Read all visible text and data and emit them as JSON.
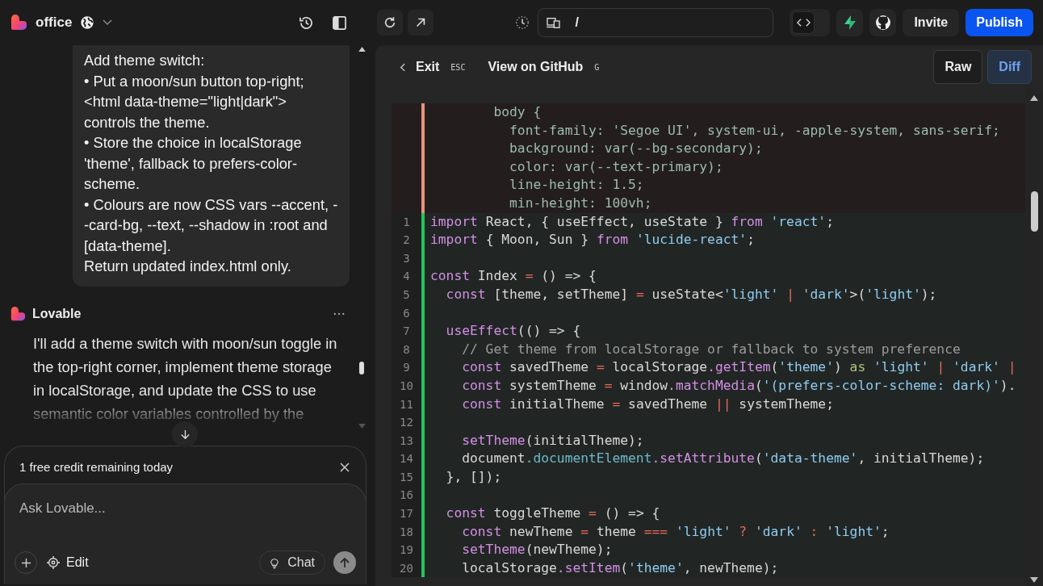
{
  "topbar": {
    "project": "office",
    "address": "/",
    "code_view": {
      "selected": true
    },
    "invite": "Invite",
    "publish": "Publish"
  },
  "chat": {
    "user_message": [
      "Add theme switch:",
      "• Put a moon/sun button top-right; <html data-theme=\"light|dark\"> controls the theme.",
      "• Store the choice in localStorage 'theme', fallback to prefers-color-scheme.",
      "• Colours are now CSS vars --accent, --card-bg, --text, --shadow in :root and [data-theme].",
      "Return updated index.html only."
    ],
    "assistant_name": "Lovable",
    "assistant_message": "I'll add a theme switch with moon/sun toggle in the top-right corner, implement theme storage in localStorage, and update the CSS to use semantic color variables controlled by the",
    "notice": "1 free credit remaining today",
    "input": {
      "placeholder": "Ask Lovable..."
    },
    "edit_button": "Edit",
    "chat_button": "Chat"
  },
  "viewer": {
    "exit": "Exit",
    "exit_key": "ESC",
    "github": "View on GitHub",
    "github_key": "G",
    "modes": [
      {
        "label": "Raw",
        "selected": false
      },
      {
        "label": "Diff",
        "selected": true
      }
    ],
    "lines": [
      {
        "kind": "removed",
        "tokens": [
          {
            "text": "        body {"
          }
        ]
      },
      {
        "kind": "removed",
        "tokens": [
          {
            "text": "          font-family: 'Segoe UI', system-ui, -apple-system, sans-serif;"
          }
        ]
      },
      {
        "kind": "removed",
        "tokens": [
          {
            "text": "          background: var(--bg-secondary);"
          }
        ]
      },
      {
        "kind": "removed",
        "tokens": [
          {
            "text": "          color: var(--text-primary);"
          }
        ]
      },
      {
        "kind": "removed",
        "tokens": [
          {
            "text": "          line-height: 1.5;"
          }
        ]
      },
      {
        "kind": "removed",
        "tokens": [
          {
            "text": "          min-height: 100vh;"
          }
        ]
      },
      {
        "kind": "added",
        "number": "1",
        "tokens": [
          {
            "text": "import",
            "kind": "kw"
          },
          {
            "text": " React, { useEffect, useState } "
          },
          {
            "text": "from ",
            "kind": "kw"
          },
          {
            "text": "'react'",
            "kind": "str"
          },
          {
            "text": ";"
          }
        ]
      },
      {
        "kind": "added",
        "number": "2",
        "tokens": [
          {
            "text": "import",
            "kind": "kw"
          },
          {
            "text": " { Moon, Sun } "
          },
          {
            "text": "from ",
            "kind": "kw"
          },
          {
            "text": "'lucide-react'",
            "kind": "str"
          },
          {
            "text": ";"
          }
        ]
      },
      {
        "kind": "added",
        "number": "3"
      },
      {
        "kind": "added",
        "number": "4",
        "tokens": [
          {
            "text": "const",
            "kind": "kw"
          },
          {
            "text": " Index "
          },
          {
            "text": "=",
            "kind": "op"
          },
          {
            "text": " () => {"
          }
        ]
      },
      {
        "kind": "added",
        "number": "5",
        "tokens": [
          {
            "text": "  const",
            "kind": "kw"
          },
          {
            "text": " [theme, setTheme] "
          },
          {
            "text": "=",
            "kind": "op"
          },
          {
            "text": " useState<"
          },
          {
            "text": "'light' ",
            "kind": "str"
          },
          {
            "text": "| ",
            "kind": "op"
          },
          {
            "text": "'dark'",
            "kind": "str"
          },
          {
            "text": ">("
          },
          {
            "text": "'light'",
            "kind": "str"
          },
          {
            "text": ");"
          }
        ]
      },
      {
        "kind": "added",
        "number": "6"
      },
      {
        "kind": "added",
        "number": "7",
        "tokens": [
          {
            "text": "  useEffect",
            "kind": "kw"
          },
          {
            "text": "(() => {"
          }
        ]
      },
      {
        "kind": "added",
        "number": "8",
        "tokens": [
          {
            "text": "    // Get theme from localStorage or fallback to system preference",
            "kind": "cm"
          }
        ]
      },
      {
        "kind": "added",
        "number": "9",
        "tokens": [
          {
            "text": "    const",
            "kind": "kw"
          },
          {
            "text": " savedTheme "
          },
          {
            "text": "=",
            "kind": "op"
          },
          {
            "text": " localStorage"
          },
          {
            "text": ".getItem",
            "kind": "kw"
          },
          {
            "text": "("
          },
          {
            "text": "'theme'",
            "kind": "str"
          },
          {
            "text": ") "
          },
          {
            "text": "as ",
            "kind": "as"
          },
          {
            "text": "'light' ",
            "kind": "str"
          },
          {
            "text": "| ",
            "kind": "op"
          },
          {
            "text": "'dark' ",
            "kind": "str"
          },
          {
            "text": "|",
            "kind": "op"
          }
        ]
      },
      {
        "kind": "added",
        "number": "10",
        "tokens": [
          {
            "text": "    const",
            "kind": "kw"
          },
          {
            "text": " systemTheme "
          },
          {
            "text": "=",
            "kind": "op"
          },
          {
            "text": " window"
          },
          {
            "text": ".matchMedia",
            "kind": "kw"
          },
          {
            "text": "("
          },
          {
            "text": "'(prefers-color-scheme: dark)'",
            "kind": "str"
          },
          {
            "text": ")."
          }
        ]
      },
      {
        "kind": "added",
        "number": "11",
        "tokens": [
          {
            "text": "    const",
            "kind": "kw"
          },
          {
            "text": " initialTheme "
          },
          {
            "text": "=",
            "kind": "op"
          },
          {
            "text": " savedTheme "
          },
          {
            "text": "||",
            "kind": "op"
          },
          {
            "text": " systemTheme;"
          }
        ]
      },
      {
        "kind": "added",
        "number": "12"
      },
      {
        "kind": "added",
        "number": "13",
        "tokens": [
          {
            "text": "    setTheme",
            "kind": "kw"
          },
          {
            "text": "(initialTheme);"
          }
        ]
      },
      {
        "kind": "added",
        "number": "14",
        "tokens": [
          {
            "text": "    document"
          },
          {
            "text": ".documentElement",
            "kind": "fn"
          },
          {
            "text": ".setAttribute",
            "kind": "kw"
          },
          {
            "text": "("
          },
          {
            "text": "'data-theme'",
            "kind": "str"
          },
          {
            "text": ", initialTheme);"
          }
        ]
      },
      {
        "kind": "added",
        "number": "15",
        "tokens": [
          {
            "text": "  }, []);"
          }
        ]
      },
      {
        "kind": "added",
        "number": "16"
      },
      {
        "kind": "added",
        "number": "17",
        "tokens": [
          {
            "text": "  const",
            "kind": "kw"
          },
          {
            "text": " toggleTheme "
          },
          {
            "text": "=",
            "kind": "op"
          },
          {
            "text": " () => {"
          }
        ]
      },
      {
        "kind": "added",
        "number": "18",
        "tokens": [
          {
            "text": "    const",
            "kind": "kw"
          },
          {
            "text": " newTheme "
          },
          {
            "text": "=",
            "kind": "op"
          },
          {
            "text": " theme "
          },
          {
            "text": "=== ",
            "kind": "op"
          },
          {
            "text": "'light' ",
            "kind": "str"
          },
          {
            "text": "? ",
            "kind": "op"
          },
          {
            "text": "'dark' ",
            "kind": "str"
          },
          {
            "text": ": ",
            "kind": "op"
          },
          {
            "text": "'light'",
            "kind": "str"
          },
          {
            "text": ";"
          }
        ]
      },
      {
        "kind": "added",
        "number": "19",
        "tokens": [
          {
            "text": "    setTheme",
            "kind": "kw"
          },
          {
            "text": "(newTheme);"
          }
        ]
      },
      {
        "kind": "added",
        "number": "20",
        "tokens": [
          {
            "text": "    localStorage"
          },
          {
            "text": ".setItem",
            "kind": "kw"
          },
          {
            "text": "("
          },
          {
            "text": "'theme'",
            "kind": "str"
          },
          {
            "text": ", newTheme);"
          }
        ]
      }
    ]
  }
}
